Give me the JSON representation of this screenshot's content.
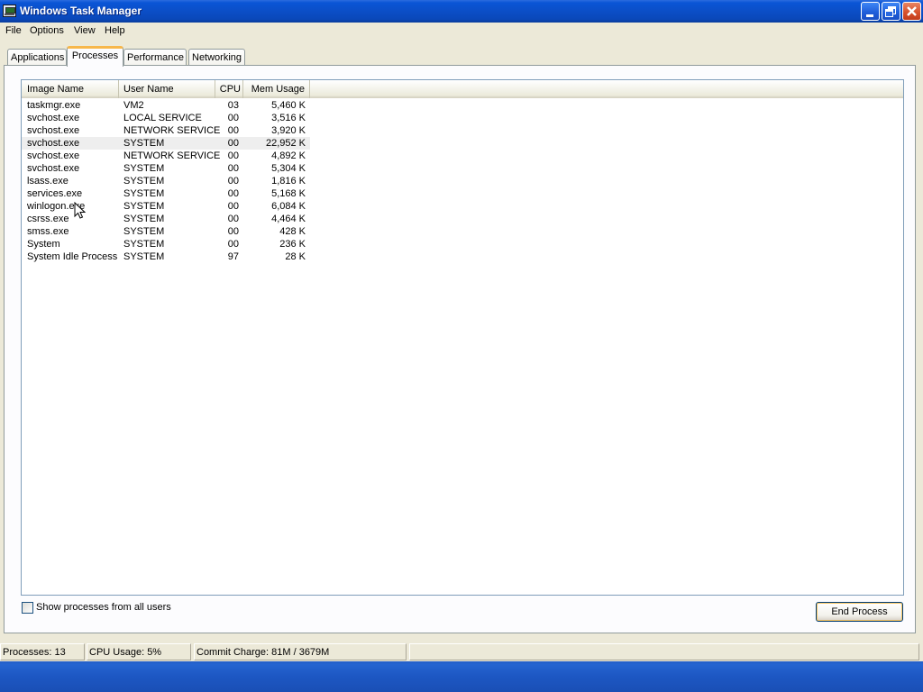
{
  "window": {
    "title": "Windows Task Manager"
  },
  "menu": [
    "File",
    "Options",
    "View",
    "Help"
  ],
  "tabs": [
    {
      "label": "Applications",
      "active": false
    },
    {
      "label": "Processes",
      "active": true
    },
    {
      "label": "Performance",
      "active": false
    },
    {
      "label": "Networking",
      "active": false
    }
  ],
  "process_list": {
    "columns": [
      "Image Name",
      "User Name",
      "CPU",
      "Mem Usage"
    ],
    "rows": [
      {
        "image": "taskmgr.exe",
        "user": "VM2",
        "cpu": "03",
        "mem": "5,460 K"
      },
      {
        "image": "svchost.exe",
        "user": "LOCAL SERVICE",
        "cpu": "00",
        "mem": "3,516 K"
      },
      {
        "image": "svchost.exe",
        "user": "NETWORK SERVICE",
        "cpu": "00",
        "mem": "3,920 K"
      },
      {
        "image": "svchost.exe",
        "user": "SYSTEM",
        "cpu": "00",
        "mem": "22,952 K",
        "selected": true
      },
      {
        "image": "svchost.exe",
        "user": "NETWORK SERVICE",
        "cpu": "00",
        "mem": "4,892 K"
      },
      {
        "image": "svchost.exe",
        "user": "SYSTEM",
        "cpu": "00",
        "mem": "5,304 K"
      },
      {
        "image": "lsass.exe",
        "user": "SYSTEM",
        "cpu": "00",
        "mem": "1,816 K"
      },
      {
        "image": "services.exe",
        "user": "SYSTEM",
        "cpu": "00",
        "mem": "5,168 K"
      },
      {
        "image": "winlogon.exe",
        "user": "SYSTEM",
        "cpu": "00",
        "mem": "6,084 K"
      },
      {
        "image": "csrss.exe",
        "user": "SYSTEM",
        "cpu": "00",
        "mem": "4,464 K"
      },
      {
        "image": "smss.exe",
        "user": "SYSTEM",
        "cpu": "00",
        "mem": "428 K"
      },
      {
        "image": "System",
        "user": "SYSTEM",
        "cpu": "00",
        "mem": "236 K"
      },
      {
        "image": "System Idle Process",
        "user": "SYSTEM",
        "cpu": "97",
        "mem": "28 K"
      }
    ]
  },
  "controls": {
    "show_all_label": "Show processes from all users",
    "show_all_checked": false,
    "end_process_label": "End Process"
  },
  "status": {
    "processes": "Processes: 13",
    "cpu_usage": "CPU Usage: 5%",
    "commit_charge": "Commit Charge: 81M / 3679M"
  },
  "icons": {
    "app": "task-manager-icon",
    "minimize": "minimize-icon",
    "maximize": "restore-icon",
    "close": "close-icon",
    "cursor": "mouse-pointer-icon"
  }
}
